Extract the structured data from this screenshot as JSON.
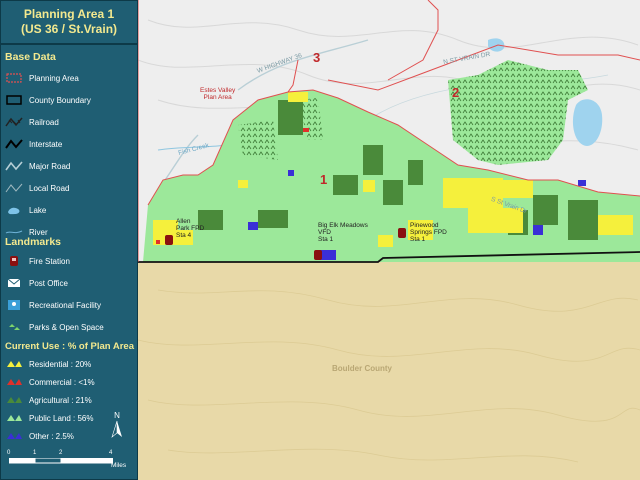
{
  "title": {
    "line1": "Planning Area 1",
    "line2": "(US 36 / St.Vrain)"
  },
  "legend": {
    "base_heading": "Base Data",
    "base_items": [
      {
        "label": "Planning Area",
        "icon": "planning-area-icon"
      },
      {
        "label": "County Boundary",
        "icon": "county-boundary-icon"
      },
      {
        "label": "Railroad",
        "icon": "railroad-icon"
      },
      {
        "label": "Interstate",
        "icon": "interstate-icon"
      },
      {
        "label": "Major Road",
        "icon": "major-road-icon"
      },
      {
        "label": "Local Road",
        "icon": "local-road-icon"
      },
      {
        "label": "Lake",
        "icon": "lake-icon"
      },
      {
        "label": "River",
        "icon": "river-icon"
      }
    ],
    "landmarks_heading": "Landmarks",
    "landmark_items": [
      {
        "label": "Fire Station",
        "icon": "fire-station-icon"
      },
      {
        "label": "Post Office",
        "icon": "post-office-icon"
      },
      {
        "label": "Recreational Facility",
        "icon": "recreation-icon"
      },
      {
        "label": "Parks & Open Space",
        "icon": "parks-icon"
      }
    ],
    "use_heading": "Current Use : % of Plan Area",
    "use_items": [
      {
        "label": "Residential : 20%",
        "color": "#f5f03c"
      },
      {
        "label": "Commercial : <1%",
        "color": "#e0302a"
      },
      {
        "label": "Agricultural : 21%",
        "color": "#4a8a3a"
      },
      {
        "label": "Public Land : 56%",
        "color": "#9ce89a"
      },
      {
        "label": "Other : 2.5%",
        "color": "#3a2fd6"
      }
    ],
    "scale": {
      "ticks": [
        "0",
        "1",
        "2",
        "4"
      ],
      "unit": "Miles"
    },
    "north": "N"
  },
  "map": {
    "area_numbers": [
      "1",
      "2",
      "3"
    ],
    "county_label": "Boulder County",
    "place_labels": {
      "estes": [
        "Estes Valley",
        "Plan Area"
      ],
      "allenspark": [
        "Allen",
        "Park FPD",
        "Sta 4"
      ],
      "bigelk": [
        "Big Elk Meadows",
        "VFD",
        "Sta 1"
      ],
      "pinewood": [
        "Pinewood",
        "Springs FPD",
        "Sta 1"
      ]
    },
    "road_labels": [
      "W HIGHWAY 36",
      "N ST VRAIN DR",
      "Fish Creek",
      "S St Vrain Dr"
    ],
    "colors": {
      "public": "#9ce89a",
      "residential": "#f5f03c",
      "agricultural": "#4a8a3a",
      "other": "#3a2fd6",
      "commercial": "#e0302a",
      "county": "#e8d9a8",
      "terrain": "#eeeeee",
      "planning": "#e05050"
    }
  }
}
